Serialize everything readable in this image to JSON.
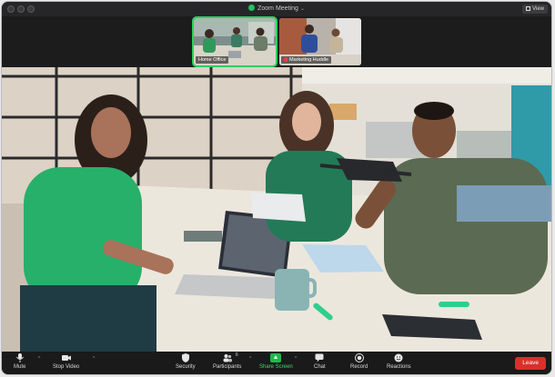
{
  "window": {
    "title": "Zoom Meeting",
    "view_label": "View"
  },
  "thumbnails": [
    {
      "label": "Home Office",
      "active": true
    },
    {
      "label": "Marketing Huddle",
      "active": false,
      "muted": true
    }
  ],
  "toolbar": {
    "mute": "Mute",
    "stop_video": "Stop Video",
    "security": "Security",
    "participants": "Participants",
    "participants_count": "6",
    "share_screen": "Share Screen",
    "chat": "Chat",
    "record": "Record",
    "reactions": "Reactions",
    "leave": "Leave"
  },
  "colors": {
    "active_border": "#2bd15b",
    "share_green": "#1fb84a",
    "leave_red": "#d9302c"
  }
}
